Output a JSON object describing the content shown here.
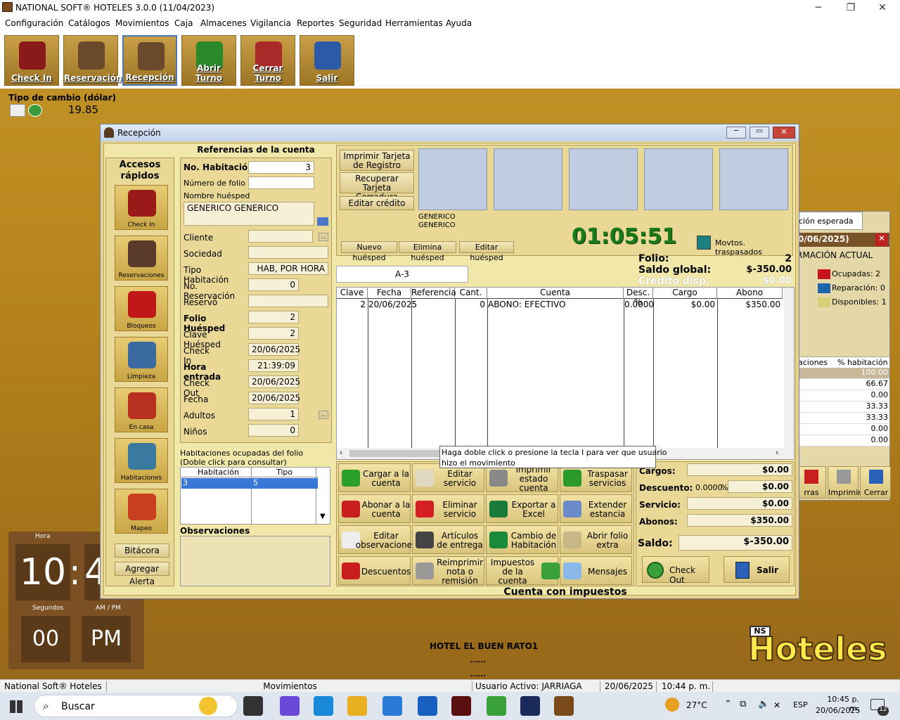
{
  "app": {
    "title": "NATIONAL SOFT® HOTELES 3.0.0 (11/04/2023)",
    "min": "─",
    "max": "❐",
    "close": "✕"
  },
  "menu": [
    "Configuración",
    "Catálogos",
    "Movimientos",
    "Caja",
    "Almacenes",
    "Vigilancia",
    "Reportes",
    "Seguridad",
    "Herramientas",
    "Ayuda"
  ],
  "toolbar": [
    {
      "label": "Check In",
      "icon": "suitcase-icon"
    },
    {
      "label": "Reservación",
      "icon": "receptionist-icon"
    },
    {
      "label": "Recepción",
      "icon": "receptionist-icon"
    },
    {
      "label": "Abrir Turno",
      "icon": "clock-open-icon"
    },
    {
      "label": "Cerrar Turno",
      "icon": "clock-close-icon"
    },
    {
      "label": "Salir",
      "icon": "exit-door-icon"
    }
  ],
  "exchange": {
    "label": "Tipo de cambio (dólar)",
    "value": "19.85"
  },
  "clock": {
    "hour_label": "Hora",
    "hour": "10",
    "sep": ":",
    "minute": "4",
    "sec_label": "Segundos",
    "seconds": "00",
    "ampm_label": "AM / PM",
    "ampm": "PM"
  },
  "hotel_name": "HOTEL EL BUEN RATO1",
  "dots": "......",
  "logo": {
    "ns": "NS",
    "text": "Hoteles"
  },
  "window": {
    "title": "Recepción",
    "min": "─",
    "max": "▭",
    "close": "✕"
  },
  "quick": {
    "title": "Accesos rápidos",
    "items": [
      "Check In",
      "Reservaciones",
      "Bloqueos",
      "Limpieza",
      "En casa",
      "Habitaciones",
      "Mapeo"
    ],
    "bitacora": "Bitácora",
    "alerta": "Agregar Alerta"
  },
  "refs": {
    "title": "Referencias de la cuenta",
    "no_hab": {
      "label": "No. Habitación",
      "value": "3"
    },
    "folio": {
      "label": "Número de folio",
      "value": ""
    },
    "nombre": {
      "label": "Nombre huésped",
      "value": "GENERICO  GENERICO"
    },
    "fields": [
      {
        "label": "Cliente",
        "value": "",
        "bold": false
      },
      {
        "label": "Sociedad",
        "value": "",
        "bold": false
      },
      {
        "label": "Tipo Habitación",
        "value": "HAB, POR HORA",
        "bold": false
      },
      {
        "label": "No. Reservación",
        "value": "0",
        "bold": false
      },
      {
        "label": "Reservó",
        "value": "",
        "bold": false
      },
      {
        "label": "Folio Huésped",
        "value": "2",
        "bold": true
      },
      {
        "label": "Clave Huésped",
        "value": "2",
        "bold": false
      },
      {
        "label": "Check In",
        "value": "20/06/2025",
        "bold": false
      },
      {
        "label": "Hora entrada",
        "value": "21:39:09",
        "bold": true
      },
      {
        "label": "Check Out",
        "value": "20/06/2025",
        "bold": false
      },
      {
        "label": "Fecha",
        "value": "20/06/2025",
        "bold": false
      },
      {
        "label": "Adultos",
        "value": "1",
        "bold": false
      },
      {
        "label": "Niños",
        "value": "0",
        "bold": false
      }
    ],
    "ocupadas_title": "Habitaciones ocupadas del folio\n(Doble click para consultar)",
    "ocupadas_cols": [
      "Habitación",
      "Tipo"
    ],
    "ocupadas_rows": [
      [
        "3",
        "5"
      ]
    ],
    "obs_title": "Observaciones"
  },
  "guest": {
    "btn_imprimir": "Imprimir Tarjeta de Registro",
    "btn_recuperar": "Recuperar Tarjeta Cerradura",
    "btn_credito": "Editar crédito",
    "names": [
      "GENERICO",
      "GENERICO"
    ],
    "nuevo": "Nuevo huésped",
    "elimina": "Elimina huésped",
    "editar": "Editar huésped",
    "timer": "01:05:51",
    "traspasados": "Movtos. traspasados"
  },
  "account": {
    "room": "A-3",
    "folio_label": "Folio:",
    "folio": "2",
    "saldo_label": "Saldo global:",
    "saldo": "$-350.00",
    "credito_label": "Crédito disp.",
    "credito": "$0.00",
    "cols": [
      "Clave",
      "Fecha",
      "Referencia",
      "Cant.",
      "Cuenta",
      "Desc. %",
      "Cargo",
      "Abono"
    ],
    "rows": [
      [
        "2",
        "20/06/2025",
        "",
        "0",
        "ABONO: EFECTIVO",
        "0.0000",
        "$0.00",
        "$350.00"
      ]
    ],
    "tooltip": "Haga doble click o presione la tecla I para ver que usuario\nhizo el movimiento"
  },
  "actions": [
    {
      "label": "Cargar a la cuenta",
      "icon": "plus-icon"
    },
    {
      "label": "Editar servicio",
      "icon": "edit-icon"
    },
    {
      "label": "Imprimir estado cuenta",
      "icon": "printer-icon"
    },
    {
      "label": "Traspasar servicios",
      "icon": "transfer-icon"
    },
    {
      "label": "Abonar a la cuenta",
      "icon": "minus-icon"
    },
    {
      "label": "Eliminar servicio",
      "icon": "delete-x-icon"
    },
    {
      "label": "Exportar a Excel",
      "icon": "excel-icon"
    },
    {
      "label": "Extender estancia",
      "icon": "extend-icon"
    },
    {
      "label": "Editar observaciones",
      "icon": "notes-icon"
    },
    {
      "label": "Artículos de entrega",
      "icon": "items-icon"
    },
    {
      "label": "Cambio de Habitación",
      "icon": "swap-icon"
    },
    {
      "label": "Abrir folio extra",
      "icon": "folio-icon"
    },
    {
      "label": "Descuentos",
      "icon": "discount-icon"
    },
    {
      "label": "Reimprimir nota o remisión",
      "icon": "reprint-icon"
    },
    {
      "label": "Impuestos de la cuenta",
      "icon": "check-icon"
    },
    {
      "label": "Mensajes",
      "icon": "message-icon"
    }
  ],
  "totals": {
    "cargos_label": "Cargos:",
    "cargos": "$0.00",
    "descuento_label": "Descuento:",
    "descuento_pct": "0.0000",
    "pct": "%",
    "descuento": "$0.00",
    "servicio_label": "Servicio:",
    "servicio": "$0.00",
    "abonos_label": "Abonos:",
    "abonos": "$350.00",
    "saldo_label": "Saldo:",
    "saldo": "$-350.00",
    "checkout": "Check Out",
    "salir": "Salir"
  },
  "cuenta_impuestos": "Cuenta con impuestos",
  "back": {
    "tab": "ción esperada",
    "date": "0/06/2025)",
    "info": "RMACIÓN ACTUAL",
    "legend": [
      {
        "label": "Ocupadas: 2",
        "color": "#c8141e"
      },
      {
        "label": "Reparación: 0",
        "color": "#1e64a8"
      },
      {
        "label": "Disponibles: 1",
        "color": "#d8d078"
      }
    ],
    "cols": [
      "aciones",
      "% habitación"
    ],
    "pct": [
      "100.00",
      "66.67",
      "0.00",
      "33.33",
      "33.33",
      "0.00",
      "0.00"
    ],
    "btns": [
      "rras",
      "Imprimir",
      "Cerrar"
    ]
  },
  "status": {
    "app": "National Soft® Hoteles 3.0.0",
    "mod": "Movimientos",
    "user": "Usuario Activo: JARRIAGA",
    "date": "20/06/2025",
    "time": "10:44 p. m."
  },
  "taskbar": {
    "search": "Buscar",
    "temp": "27°C",
    "lang": "ESP",
    "time": "10:45 p. m.",
    "date": "20/06/2025",
    "notif": "12"
  }
}
